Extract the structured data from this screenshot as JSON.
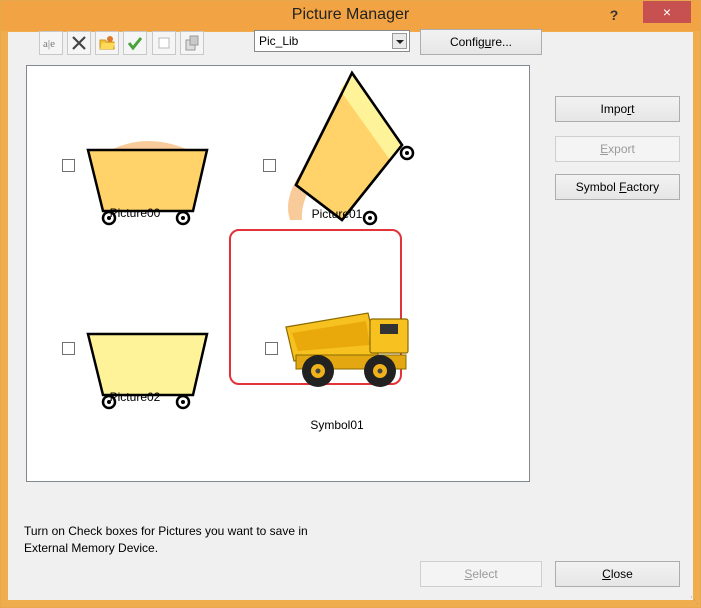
{
  "window": {
    "title": "Picture Manager",
    "help_glyph": "?",
    "close_glyph": "×"
  },
  "toolbar": {
    "icons": [
      "rename-icon",
      "delete-icon",
      "folder-icon",
      "check-all-icon",
      "uncheck-icon",
      "copy-icon"
    ],
    "library_value": "Pic_Lib",
    "configure": {
      "pre": "Config",
      "key": "u",
      "post": "re..."
    }
  },
  "side_buttons": {
    "import": {
      "pre": "Impo",
      "key": "r",
      "post": "t"
    },
    "export": {
      "pre": "",
      "key": "E",
      "post": "xport"
    },
    "symbol_factory": {
      "pre": "Symbol ",
      "key": "F",
      "post": "actory"
    }
  },
  "pictures": [
    {
      "name": "Picture00",
      "checked": false
    },
    {
      "name": "Picture01",
      "checked": false
    },
    {
      "name": "Picture02",
      "checked": false
    },
    {
      "name": "Symbol01",
      "checked": false
    }
  ],
  "note": {
    "line1": "Turn on Check boxes for Pictures you want to save in",
    "line2": "External Memory Device."
  },
  "footer": {
    "select": {
      "pre": "",
      "key": "S",
      "post": "elect"
    },
    "close": {
      "pre": "",
      "key": "C",
      "post": "lose"
    }
  },
  "colors": {
    "title_bar": "#f2a444",
    "close_button": "#c75050",
    "highlight": "#e2323a",
    "cart_fill": "#ffd36a",
    "cart_fill_light": "#fff39a",
    "shadow": "#f8c28a"
  }
}
